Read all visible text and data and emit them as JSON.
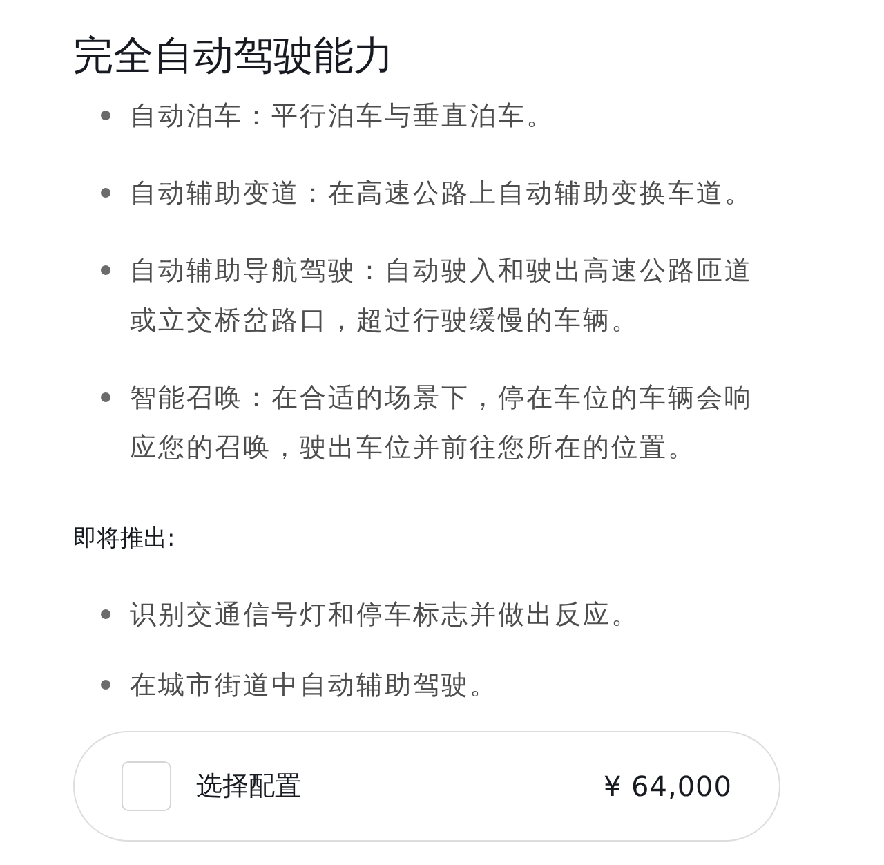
{
  "title": "完全自动驾驶能力",
  "features": [
    {
      "text": "自动泊车：平行泊车与垂直泊车。"
    },
    {
      "text": "自动辅助变道：在高速公路上自动辅助变换车道。"
    },
    {
      "text": "自动辅助导航驾驶：自动驶入和驶出高速公路匝道或立交桥岔路口，超过行驶缓慢的车辆。"
    },
    {
      "text": "智能召唤：在合适的场景下，停在车位的车辆会响应您的召唤，驶出车位并前往您所在的位置。"
    }
  ],
  "coming_soon": {
    "heading": "即将推出:",
    "items": [
      {
        "text": "识别交通信号灯和停车标志并做出反应。"
      },
      {
        "text": "在城市街道中自动辅助驾驶。"
      }
    ]
  },
  "option": {
    "checked": false,
    "label": "选择配置",
    "price": "¥ 64,000"
  }
}
